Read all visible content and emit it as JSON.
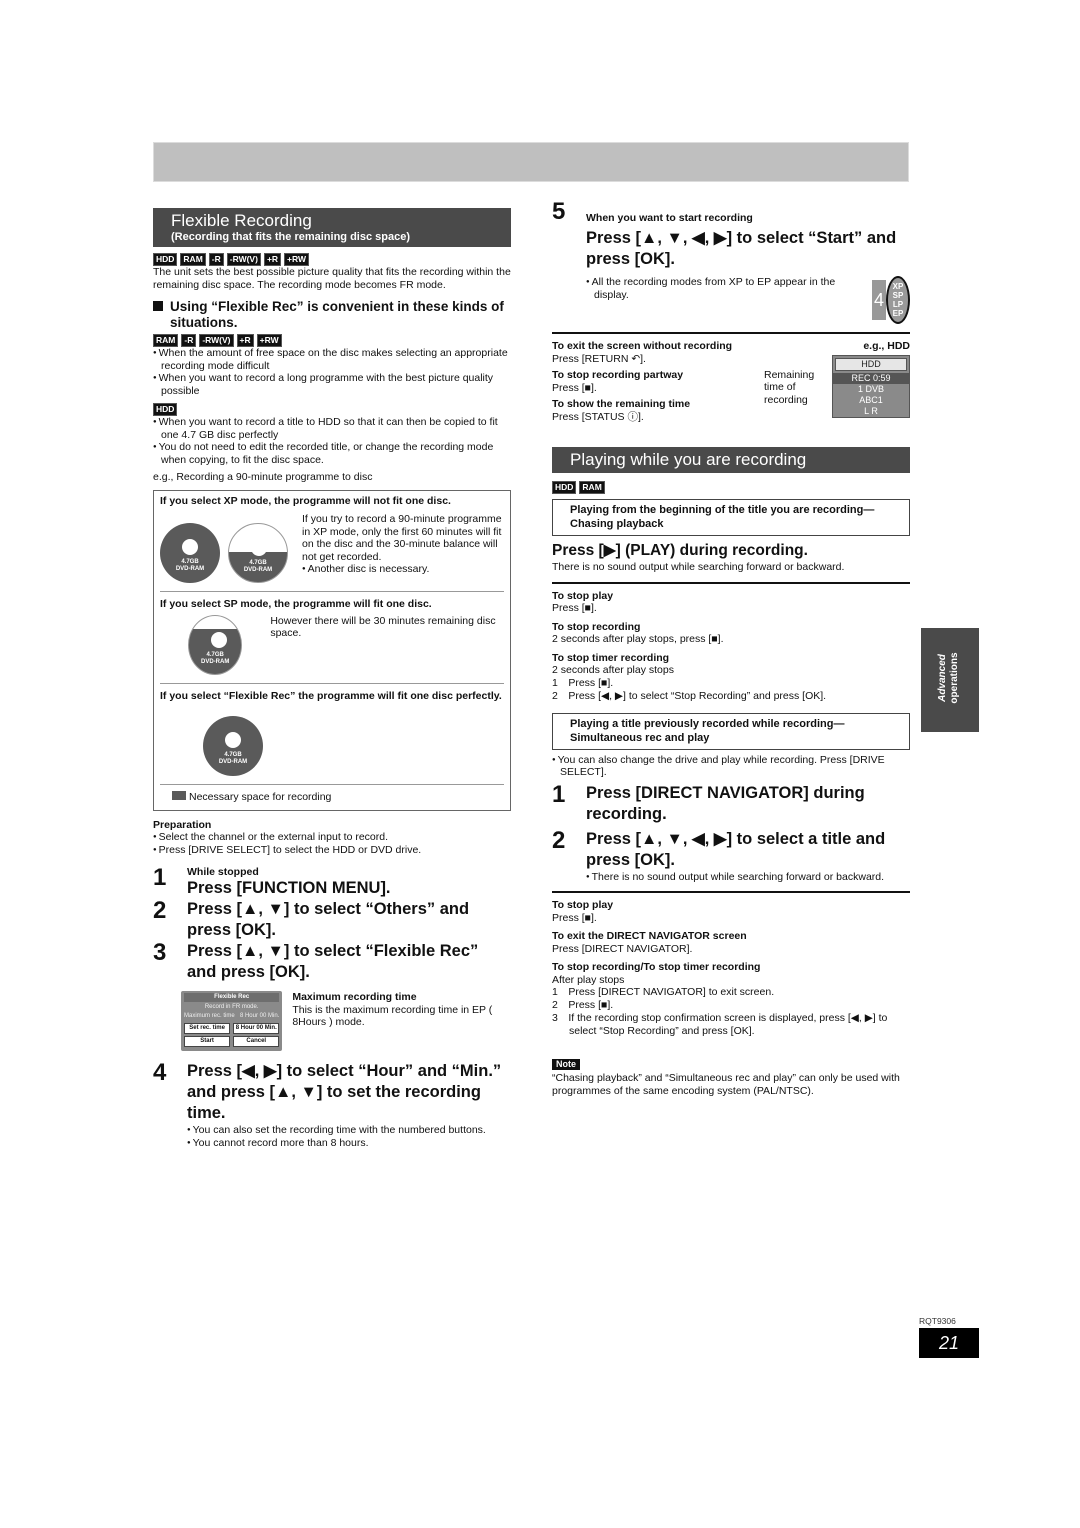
{
  "page": {
    "number": "21",
    "code": "RQT9306",
    "side_tab": [
      "Advanced",
      "operations"
    ]
  },
  "left": {
    "header": {
      "title": "Flexible Recording",
      "subtitle": "(Recording that fits the remaining disc space)"
    },
    "badges1": [
      "HDD",
      "RAM",
      "-R",
      "-RW(V)",
      "+R",
      "+RW"
    ],
    "intro": "The unit sets the best possible picture quality that fits the recording within the remaining disc space. The recording mode becomes FR mode.",
    "heading": "Using “Flexible Rec” is convenient in these kinds of situations.",
    "badges2": [
      "RAM",
      "-R",
      "-RW(V)",
      "+R",
      "+RW"
    ],
    "bullets_dvd": [
      "When the amount of free space on the disc makes selecting an appropriate recording mode difficult",
      "When you want to record a long programme with the best picture quality possible"
    ],
    "badges3": [
      "HDD"
    ],
    "bullets_hdd": [
      "When you want to record a title to HDD so that it can then be copied to fit one 4.7 GB disc perfectly",
      "You do not need to edit the recorded title, or change the recording mode when copying, to fit the disc space."
    ],
    "example": "e.g., Recording a 90-minute programme to disc",
    "box": {
      "xp_title": "If you select XP mode, the programme will not fit one disc.",
      "xp_text": "If you try to record a 90-minute programme in XP mode, only the first 60 minutes will fit on the disc and the 30-minute balance will not get recorded.",
      "xp_bullet": "Another disc is necessary.",
      "sp_title": "If you select SP mode, the programme will fit one disc.",
      "sp_text": "However there will be 30 minutes remaining disc space.",
      "fr_title": "If you select “Flexible Rec” the programme will fit one disc perfectly.",
      "legend": "Necessary space for recording",
      "disc_size": "4.7GB",
      "disc_type": "DVD-RAM"
    },
    "preparation": {
      "title": "Preparation",
      "items": [
        "Select the channel or the external input to record.",
        "Press [DRIVE SELECT] to select the HDD or DVD drive."
      ]
    },
    "steps": [
      {
        "num": "1",
        "pre": "While stopped",
        "text": "Press [FUNCTION MENU]."
      },
      {
        "num": "2",
        "text": "Press [▲, ▼] to select “Others” and press [OK]."
      },
      {
        "num": "3",
        "text": "Press [▲, ▼] to select “Flexible Rec” and press [OK]."
      },
      {
        "num": "4",
        "text": "Press [◀, ▶] to select “Hour” and “Min.” and press [▲, ▼] to set the recording time."
      }
    ],
    "osd": {
      "title": "Flexible Rec",
      "line1": "Record in FR mode.",
      "max_label": "Maximum rec. time",
      "max_value": "8 Hour 00 Min.",
      "set_label": "Set rec. time",
      "set_value": "8 Hour 00 Min.",
      "start": "Start",
      "cancel": "Cancel"
    },
    "max_callout": {
      "title": "Maximum recording time",
      "text": "This is the maximum recording time in EP ( 8Hours ) mode."
    },
    "step4_bullets": [
      "You can also set the recording time with the numbered buttons.",
      "You cannot record more than 8 hours."
    ]
  },
  "right": {
    "step5": {
      "num": "5",
      "pre": "When you want to start recording",
      "text": "Press [▲, ▼, ◀, ▶] to select “Start” and press [OK].",
      "bullet": "All the recording modes from XP to EP appear in the display."
    },
    "display_modes": [
      "XP",
      "SP",
      "LP",
      "EP"
    ],
    "display_digit": "4",
    "tips": [
      {
        "h": "To exit the screen without recording",
        "b": "Press [RETURN ↶]."
      },
      {
        "h": "To stop recording partway",
        "b": "Press [■]."
      },
      {
        "h": "To show the remaining time",
        "b": "Press [STATUS ⓘ]."
      }
    ],
    "eg": "e.g., HDD",
    "remaining_label": "Remaining time of recording",
    "hdd_display": [
      "HDD",
      "REC 0:59",
      "1 DVB",
      "ABC1",
      "L R"
    ],
    "section2": {
      "title": "Playing while you are recording",
      "badges": [
        "HDD",
        "RAM"
      ]
    },
    "chasing": {
      "box": "Playing from the beginning of the title you are recording—Chasing playback",
      "step": "Press [▶] (PLAY) during recording.",
      "note": "There is no sound output while searching forward or backward.",
      "tips": [
        {
          "h": "To stop play",
          "b": "Press [■]."
        },
        {
          "h": "To stop recording",
          "b": "2 seconds after play stops, press [■]."
        },
        {
          "h": "To stop timer recording",
          "b": "2 seconds after play stops"
        }
      ],
      "timer_steps": [
        "1 Press [■].",
        "2 Press [◀, ▶] to select “Stop Recording” and press [OK]."
      ]
    },
    "simul": {
      "box": "Playing a title previously recorded while recording—Simultaneous rec and play",
      "bullet": "You can also change the drive and play while recording. Press [DRIVE SELECT].",
      "steps": [
        {
          "num": "1",
          "text": "Press [DIRECT NAVIGATOR] during recording."
        },
        {
          "num": "2",
          "text": "Press [▲, ▼, ◀, ▶] to select a title and press [OK]."
        }
      ],
      "step2_bullet": "There is no sound output while searching forward or backward.",
      "tips": [
        {
          "h": "To stop play",
          "b": "Press [■]."
        },
        {
          "h": "To exit the DIRECT NAVIGATOR screen",
          "b": "Press [DIRECT NAVIGATOR]."
        },
        {
          "h": "To stop recording/To stop timer recording",
          "b": "After play stops"
        }
      ],
      "stop_steps": [
        "1 Press [DIRECT NAVIGATOR] to exit screen.",
        "2 Press [■].",
        "3 If the recording stop confirmation screen is displayed, press [◀, ▶] to select “Stop Recording” and press [OK]."
      ]
    },
    "note": {
      "label": "Note",
      "text": "“Chasing playback” and “Simultaneous rec and play” can only be used with programmes of the same encoding system (PAL/NTSC)."
    }
  }
}
